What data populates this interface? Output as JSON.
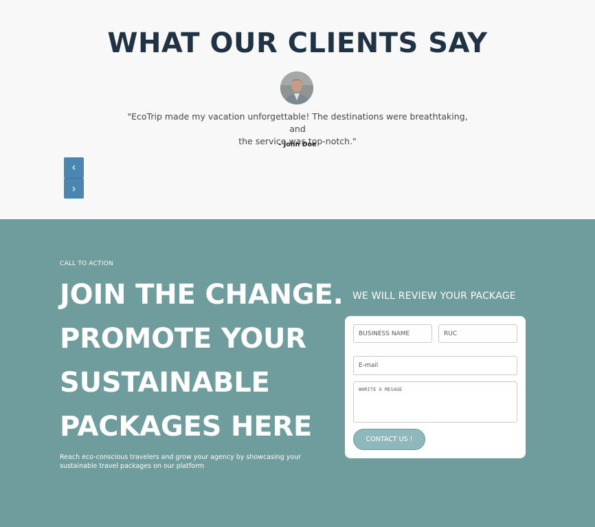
{
  "testimonials": {
    "title": "WHAT OUR CLIENTS SAY",
    "quote_line1": "\"EcoTrip made my vacation unforgettable! The destinations were breathtaking, and",
    "quote_line2": "the service was top-notch.\"",
    "author": "- John Doe",
    "prev_icon": "chevron-left-icon",
    "next_icon": "chevron-right-icon",
    "prev_glyph": "‹",
    "next_glyph": "›"
  },
  "cta": {
    "kicker": "CALL TO ACTION",
    "heading_lines": [
      "JOIN THE CHANGE.",
      "PROMOTE YOUR",
      "SUSTAINABLE",
      "PACKAGES HERE"
    ],
    "description_line1": "Reach eco-conscious travelers and grow your agency by showcasing your",
    "description_line2": "sustainable travel packages on our platform",
    "form_title": "WE WILL REVIEW YOUR PACKAGE",
    "form": {
      "business_placeholder": "BUSINESS NAME",
      "ruc_placeholder": "RUC",
      "email_placeholder": "E-mail",
      "message_placeholder": "WHRITE A MESAGE",
      "submit_label": "CONTACT US !"
    }
  },
  "colors": {
    "title": "#1f3344",
    "nav_button": "#4a87b0",
    "cta_background": "#6f9c9c",
    "submit_button": "#8fb8bc"
  }
}
